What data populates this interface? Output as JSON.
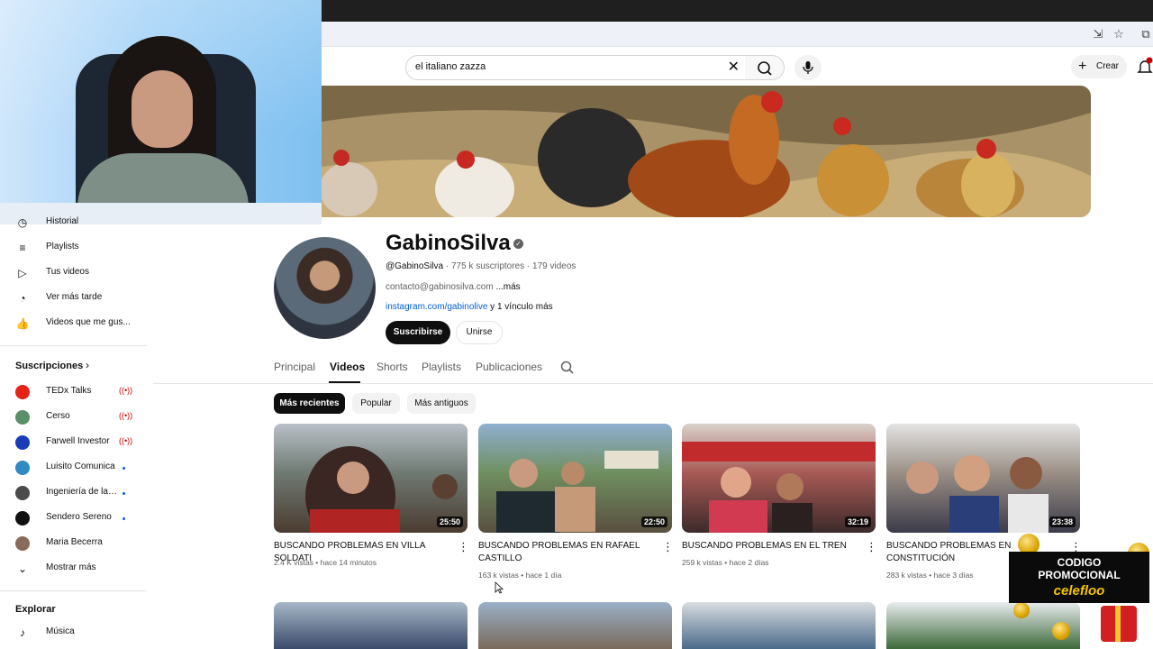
{
  "search": {
    "query": "el italiano zazza"
  },
  "header": {
    "create_label": "Crear"
  },
  "sidebar": {
    "items": [
      {
        "label": "Historial",
        "icon": "history-icon"
      },
      {
        "label": "Playlists",
        "icon": "playlist-icon"
      },
      {
        "label": "Tus videos",
        "icon": "your-videos-icon"
      },
      {
        "label": "Ver más tarde",
        "icon": "watch-later-icon"
      },
      {
        "label": "Videos que me gus...",
        "icon": "liked-videos-icon"
      }
    ],
    "subscriptions_title": "Suscripciones",
    "subscriptions": [
      {
        "name": "TEDx Talks",
        "status": "live",
        "color": "#e62117"
      },
      {
        "name": "Cerso",
        "status": "live",
        "color": "#5a8f6a"
      },
      {
        "name": "Farwell Investor",
        "status": "live",
        "color": "#1a3bb8"
      },
      {
        "name": "Luisito Comunica",
        "status": "new",
        "color": "#2f8ac4"
      },
      {
        "name": "Ingeniería de la ...",
        "status": "new",
        "color": "#4a4a4a"
      },
      {
        "name": "Sendero Sereno",
        "status": "new",
        "color": "#111111"
      },
      {
        "name": "Maria Becerra",
        "status": "none",
        "color": "#8a6a5a"
      }
    ],
    "show_more": "Mostrar más",
    "explore_title": "Explorar",
    "explore_first": "Música"
  },
  "channel": {
    "name": "GabinoSilva",
    "handle": "@GabinoSilva",
    "subscribers": "775 k suscriptores",
    "videos_count": "179 videos",
    "description": "contacto@gabinosilva.com",
    "more": "...más",
    "link": "instagram.com/gabinolive",
    "link_more": "y 1 vínculo más",
    "subscribe": "Suscribirse",
    "join": "Unirse"
  },
  "tabs": [
    "Principal",
    "Videos",
    "Shorts",
    "Playlists",
    "Publicaciones"
  ],
  "active_tab": "Videos",
  "chips": [
    "Más recientes",
    "Popular",
    "Más antiguos"
  ],
  "videos": [
    {
      "title": "BUSCANDO PROBLEMAS EN VILLA SOLDATI",
      "duration": "25:50",
      "views": "2.4 K vistas",
      "age": "hace 14 minutos"
    },
    {
      "title": "BUSCANDO PROBLEMAS EN RAFAEL CASTILLO",
      "duration": "22:50",
      "views": "163 k vistas",
      "age": "hace 1 día"
    },
    {
      "title": "BUSCANDO PROBLEMAS EN EL TREN",
      "duration": "32:19",
      "views": "259 k vistas",
      "age": "hace 2 días"
    },
    {
      "title": "BUSCANDO PROBLEMAS EN CONSTITUCIÓN",
      "duration": "23:38",
      "views": "283 k vistas",
      "age": "hace 3 días"
    }
  ],
  "promo": {
    "line1": "CODIGO",
    "line2": "PROMOCIONAL",
    "line3": "celefloo"
  },
  "colors": {
    "accent": "#0f0f0f",
    "link": "#065fd4",
    "live": "#cc0000",
    "promo_yellow": "#f5c400"
  }
}
